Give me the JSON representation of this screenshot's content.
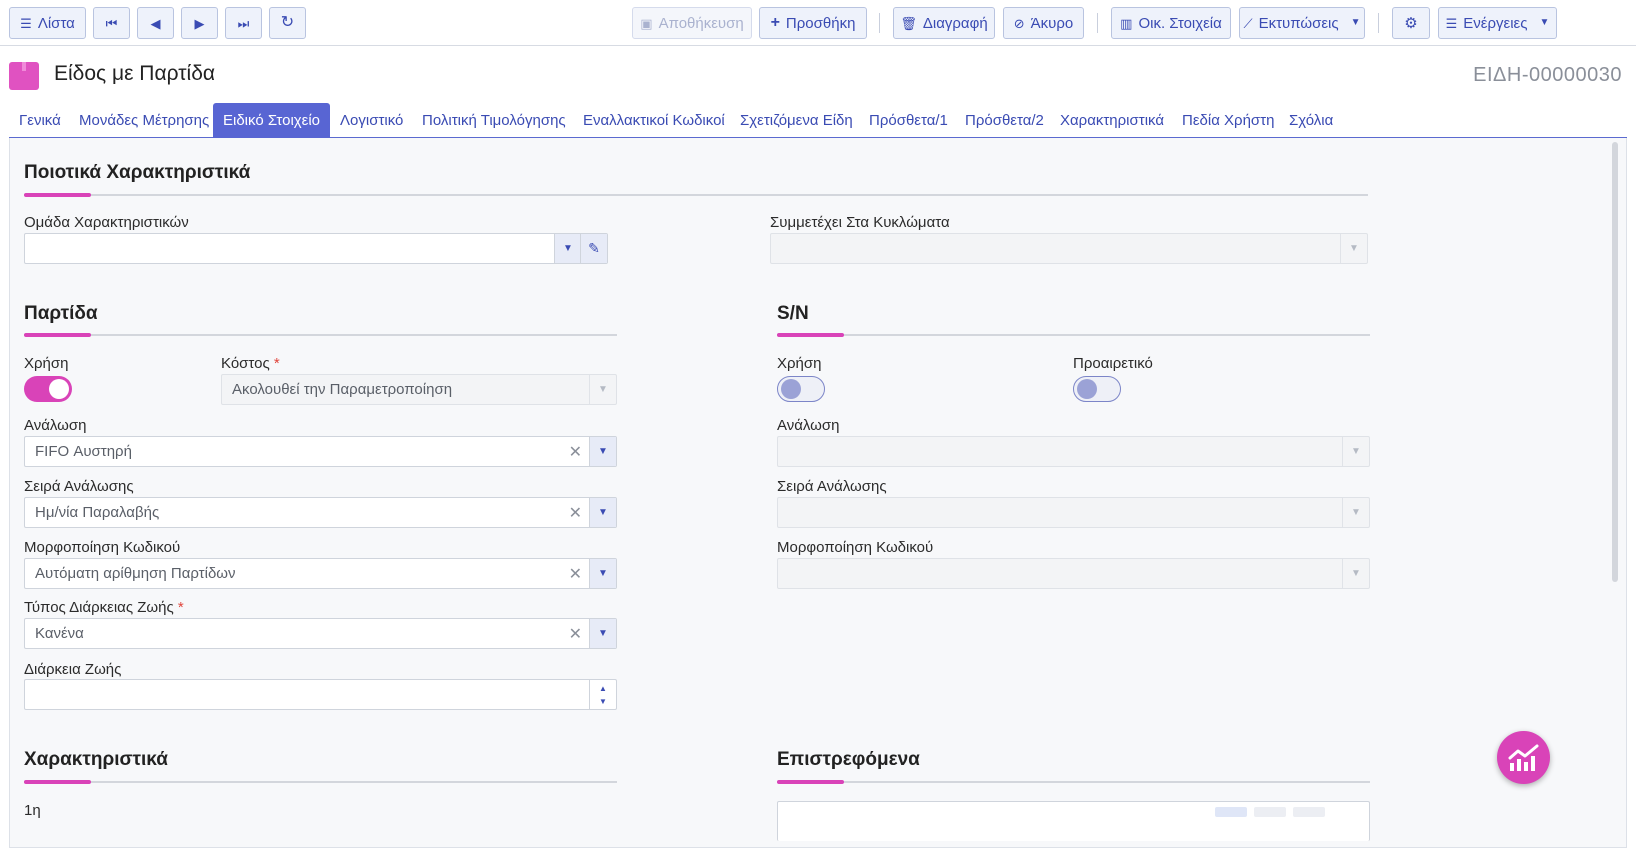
{
  "toolbar": {
    "list_label": "Λίστα",
    "save_label": "Αποθήκευση",
    "add_label": "Προσθήκη",
    "delete_label": "Διαγραφή",
    "cancel_label": "Άκυρο",
    "financials_label": "Οικ. Στοιχεία",
    "prints_label": "Εκτυπώσεις",
    "actions_label": "Ενέργειες"
  },
  "header": {
    "title": "Είδος με Παρτίδα",
    "code": "ΕΙΔΗ-00000030"
  },
  "tabs": [
    {
      "label": "Γενικά"
    },
    {
      "label": "Μονάδες Μέτρησης"
    },
    {
      "label": "Ειδικό Στοιχείο"
    },
    {
      "label": "Λογιστικό"
    },
    {
      "label": "Πολιτική Τιμολόγησης"
    },
    {
      "label": "Εναλλακτικοί Κωδικοί"
    },
    {
      "label": "Σχετιζόμενα Είδη"
    },
    {
      "label": "Πρόσθετα/1"
    },
    {
      "label": "Πρόσθετα/2"
    },
    {
      "label": "Χαρακτηριστικά"
    },
    {
      "label": "Πεδία Χρήστη"
    },
    {
      "label": "Σχόλια"
    }
  ],
  "active_tab": "Ειδικό Στοιχείο",
  "quality": {
    "section_title": "Ποιοτικά Χαρακτηριστικά",
    "attr_group_label": "Ομάδα Χαρακτηριστικών",
    "attr_group_value": "",
    "circuits_label": "Συμμετέχει Στα Κυκλώματα",
    "circuits_value": ""
  },
  "batch": {
    "section_title": "Παρτίδα",
    "use_label": "Χρήση",
    "use_on": true,
    "cost_label": "Κόστος",
    "cost_value": "Ακολουθεί την Παραμετροποίηση",
    "consumption_label": "Ανάλωση",
    "consumption_value": "FIFO Αυστηρή",
    "consumption_order_label": "Σειρά Ανάλωσης",
    "consumption_order_value": "Ημ/νία Παραλαβής",
    "code_format_label": "Μορφοποίηση Κωδικού",
    "code_format_value": "Αυτόματη αρίθμηση Παρτίδων",
    "shelf_life_type_label": "Τύπος Διάρκειας Ζωής",
    "shelf_life_type_value": "Κανένα",
    "shelf_life_label": "Διάρκεια Ζωής",
    "shelf_life_value": ""
  },
  "serial": {
    "section_title": "S/N",
    "use_label": "Χρήση",
    "use_on": false,
    "optional_label": "Προαιρετικό",
    "optional_on": false,
    "consumption_label": "Ανάλωση",
    "consumption_order_label": "Σειρά Ανάλωσης",
    "code_format_label": "Μορφοποίηση Κωδικού"
  },
  "characteristics": {
    "section_title": "Χαρακτηριστικά",
    "first_label": "1η"
  },
  "returnables": {
    "section_title": "Επιστρεφόμενα"
  },
  "colors": {
    "accent": "#5865d3",
    "brand": "#d943b8",
    "required": "#e0453c"
  }
}
